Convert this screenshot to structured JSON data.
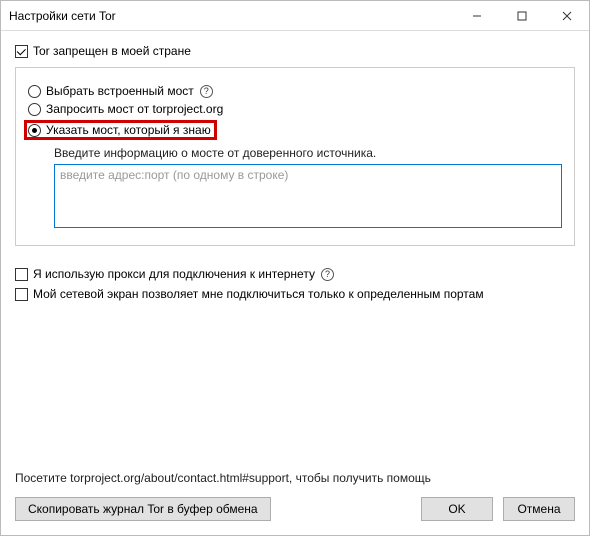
{
  "window": {
    "title": "Настройки сети Tor"
  },
  "topCheckbox": {
    "label": "Tor запрещен в моей стране",
    "checked": true
  },
  "bridgeOptions": {
    "builtin": {
      "label": "Выбрать встроенный мост",
      "checked": false
    },
    "request": {
      "label": "Запросить мост от torproject.org",
      "checked": false
    },
    "known": {
      "label": "Указать мост, который я знаю",
      "checked": true
    }
  },
  "bridgeEntry": {
    "instruction": "Введите информацию о мосте от доверенного источника.",
    "placeholder": "введите адрес:порт (по одному в строке)",
    "value": ""
  },
  "proxyCheckbox": {
    "label": "Я использую прокси для подключения к интернету",
    "checked": false
  },
  "firewallCheckbox": {
    "label": "Мой сетевой экран позволяет мне подключиться только к определенным портам",
    "checked": false
  },
  "visitLine": "Посетите torproject.org/about/contact.html#support, чтобы получить помощь",
  "buttons": {
    "copyLog": "Скопировать журнал Tor в буфер обмена",
    "ok": "OK",
    "cancel": "Отмена"
  }
}
